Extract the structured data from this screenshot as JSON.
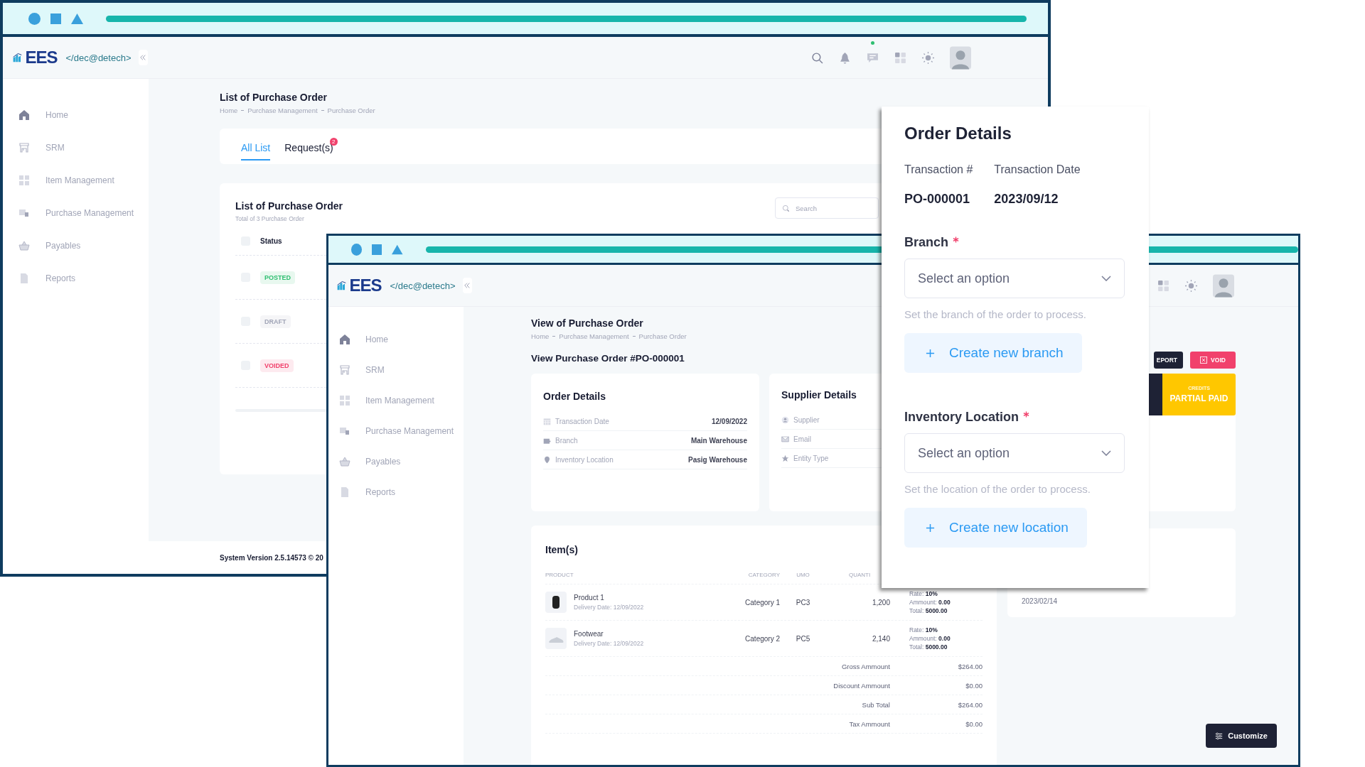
{
  "back_window": {
    "logo": {
      "mark": "EES",
      "tagline": "</dec@detech>"
    },
    "header": {
      "chat_unread": true
    },
    "sidebar": {
      "items": [
        {
          "label": "Home"
        },
        {
          "label": "SRM"
        },
        {
          "label": "Item Management"
        },
        {
          "label": "Purchase Management"
        },
        {
          "label": "Payables"
        },
        {
          "label": "Reports"
        }
      ]
    },
    "page_title": "List of Purchase Order",
    "breadcrumbs": [
      "Home",
      "Purchase Management",
      "Purchase Order"
    ],
    "tabs": [
      {
        "label": "All List",
        "selected": true
      },
      {
        "label": "Request(s)",
        "selected": false,
        "badge": "2"
      }
    ],
    "list": {
      "title": "List of Purchase Order",
      "subtitle": "Total of 3 Purchase Order",
      "search": {
        "placeholder": "Search"
      },
      "status_header": "Status",
      "header_checked": false,
      "rows": [
        {
          "status": "POSTED",
          "color": "#2fbf71",
          "checked": false
        },
        {
          "status": "DRAFT",
          "color": "#a1a5b7",
          "checked": false
        },
        {
          "status": "VOIDED",
          "color": "#f1416c",
          "checked": false
        }
      ]
    },
    "footer": "System Version 2.5.14573 © 20"
  },
  "front_window": {
    "logo": {
      "mark": "EES",
      "tagline": "</dec@detech>"
    },
    "sidebar": {
      "items": [
        {
          "label": "Home"
        },
        {
          "label": "SRM"
        },
        {
          "label": "Item Management"
        },
        {
          "label": "Purchase Management"
        },
        {
          "label": "Payables"
        },
        {
          "label": "Reports"
        }
      ]
    },
    "page_title": "View of Purchase Order",
    "breadcrumbs": [
      "Home",
      "Purchase Management",
      "Purchase Order"
    ],
    "heading": "View Purchase Order #PO-000001",
    "order_details": {
      "title": "Order Details",
      "rows": [
        {
          "label": "Transaction Date",
          "value": "12/09/2022"
        },
        {
          "label": "Branch",
          "value": "Main Warehouse"
        },
        {
          "label": "Inventory Location",
          "value": "Pasig Warehouse"
        }
      ]
    },
    "supplier_details": {
      "title": "Supplier Details",
      "rows": [
        {
          "label": "Supplier"
        },
        {
          "label": "Email"
        },
        {
          "label": "Entity Type"
        }
      ]
    },
    "items": {
      "title": "Item(s)",
      "columns": [
        "PRODUCT",
        "CATEGORY",
        "UMO",
        "QUANTI"
      ],
      "rows": [
        {
          "product": "Product 1",
          "delivery": "Delivery Date: 12/09/2022",
          "category": "Category 1",
          "umo": "PC3",
          "quantity": "1,200",
          "tax": [
            "Rate: **10%**",
            "Ammount: **0.00**",
            "Total: **5000.00**"
          ]
        },
        {
          "product": "Footwear",
          "delivery": "Delivery Date: 12/09/2022",
          "category": "Category 2",
          "umo": "PC5",
          "quantity": "2,140",
          "tax": [
            "Rate: **10%**",
            "Ammount: **0.00**",
            "Total: **5000.00**"
          ]
        }
      ],
      "totals": [
        {
          "label": "Gross Ammount",
          "value": "$264.00"
        },
        {
          "label": "Discount Ammount",
          "value": "$0.00"
        },
        {
          "label": "Sub Total",
          "value": "$264.00"
        },
        {
          "label": "Tax Ammount",
          "value": "$0.00"
        }
      ]
    },
    "actions": {
      "report": "EPORT",
      "void": "VOID"
    },
    "credits": {
      "label": "CREDITS",
      "value": "PARTIAL PAID"
    },
    "date": "2023/02/14",
    "customize": "Customize"
  },
  "order_panel": {
    "title": "Order Details",
    "info": [
      {
        "label": "Transaction #",
        "value": "PO-000001"
      },
      {
        "label": "Transaction Date",
        "value": "2023/09/12"
      }
    ],
    "fields": [
      {
        "label": "Branch",
        "required": true,
        "placeholder": "Select an option",
        "hint": "Set the branch of the order to process.",
        "create": "Create new branch"
      },
      {
        "label": "Inventory Location",
        "required": true,
        "placeholder": "Select an option",
        "hint": "Set the location of the order to process.",
        "create": "Create new location"
      }
    ]
  }
}
